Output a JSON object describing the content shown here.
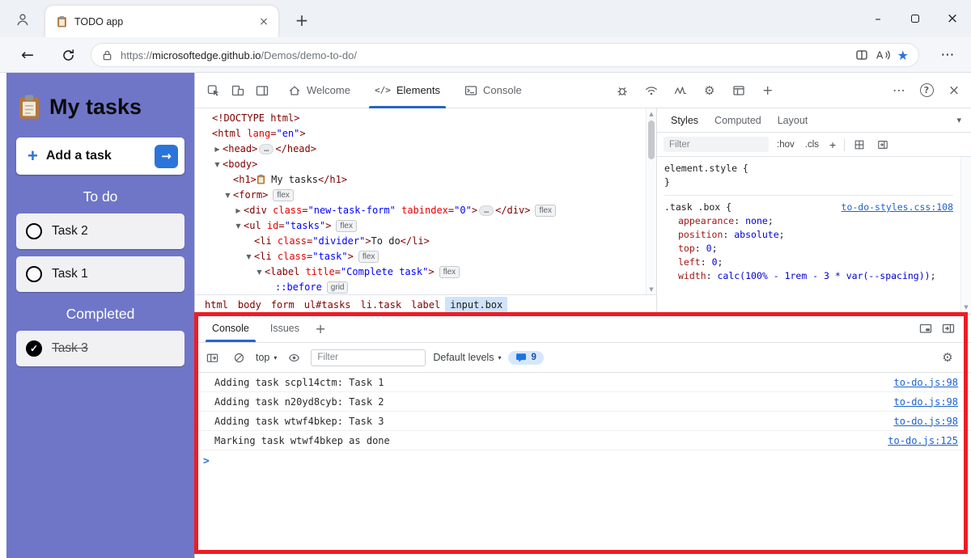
{
  "colors": {
    "app_purple": "#6f76c8",
    "accent_blue": "#2b74d9",
    "annotation_red": "#ee1c25",
    "link_blue": "#1b62d0",
    "devtools_active_tab": "#2864c8"
  },
  "glyphs": {
    "close": "×",
    "minimize": "–",
    "new_tab": "+",
    "back": "←",
    "more": "⋯",
    "help": "?",
    "star": "★",
    "caret_down": "▾",
    "check": "✓",
    "prompt": ">",
    "elements_code": "</>",
    "gear": "⚙",
    "plus": "+",
    "scroll_up": "▲",
    "scroll_down": "▼",
    "tree_expanded": "▼",
    "tree_collapsed": "▶"
  },
  "browser": {
    "tab": {
      "title": "TODO app"
    },
    "url": {
      "scheme": "https://",
      "host": "microsoftedge.github.io",
      "path": "/Demos/demo-to-do/"
    }
  },
  "app": {
    "title": "My tasks",
    "add_task": {
      "plus": "+",
      "label": "Add a task",
      "arrow": "→"
    },
    "sections": [
      {
        "label": "To do",
        "tasks": [
          {
            "label": "Task 2",
            "done": false
          },
          {
            "label": "Task 1",
            "done": false
          }
        ]
      },
      {
        "label": "Completed",
        "tasks": [
          {
            "label": "Task 3",
            "done": true
          }
        ]
      }
    ]
  },
  "devtools": {
    "tabs": {
      "welcome": "Welcome",
      "elements": "Elements",
      "console": "Console"
    },
    "elements_tree": [
      {
        "i": 0,
        "k": [
          {
            "c": "tag",
            "s": "<!DOCTYPE html>"
          }
        ]
      },
      {
        "i": 0,
        "k": [
          {
            "c": "tag",
            "s": "<html"
          },
          {
            "c": "attr",
            "s": " lang"
          },
          {
            "c": "tag",
            "s": "="
          },
          {
            "c": "val",
            "s": "\"en\""
          },
          {
            "c": "tag",
            "s": ">"
          }
        ]
      },
      {
        "i": 1,
        "a": "r",
        "k": [
          {
            "c": "tag",
            "s": "<head>"
          },
          {
            "e": "…"
          },
          {
            "c": "tag",
            "s": "</head>"
          }
        ]
      },
      {
        "i": 1,
        "a": "d",
        "k": [
          {
            "c": "tag",
            "s": "<body>"
          }
        ]
      },
      {
        "i": 2,
        "k": [
          {
            "c": "tag",
            "s": "<h1>"
          },
          {
            "ic": "clipboard"
          },
          {
            "c": "text",
            "s": " My tasks"
          },
          {
            "c": "tag",
            "s": "</h1>"
          }
        ]
      },
      {
        "i": 2,
        "a": "d",
        "k": [
          {
            "c": "tag",
            "s": "<form>"
          },
          {
            "b": "flex"
          }
        ]
      },
      {
        "i": 3,
        "a": "r",
        "k": [
          {
            "c": "tag",
            "s": "<div"
          },
          {
            "c": "attr",
            "s": " class"
          },
          {
            "c": "tag",
            "s": "="
          },
          {
            "c": "val",
            "s": "\"new-task-form\""
          },
          {
            "c": "attr",
            "s": " tabindex"
          },
          {
            "c": "tag",
            "s": "="
          },
          {
            "c": "val",
            "s": "\"0\""
          },
          {
            "c": "tag",
            "s": ">"
          },
          {
            "e": "…"
          },
          {
            "c": "tag",
            "s": "</div>"
          },
          {
            "b": "flex"
          }
        ]
      },
      {
        "i": 3,
        "a": "d",
        "k": [
          {
            "c": "tag",
            "s": "<ul"
          },
          {
            "c": "attr",
            "s": " id"
          },
          {
            "c": "tag",
            "s": "="
          },
          {
            "c": "val",
            "s": "\"tasks\""
          },
          {
            "c": "tag",
            "s": ">"
          },
          {
            "b": "flex"
          }
        ]
      },
      {
        "i": 4,
        "k": [
          {
            "c": "tag",
            "s": "<li"
          },
          {
            "c": "attr",
            "s": " class"
          },
          {
            "c": "tag",
            "s": "="
          },
          {
            "c": "val",
            "s": "\"divider\""
          },
          {
            "c": "tag",
            "s": ">"
          },
          {
            "c": "text",
            "s": "To do"
          },
          {
            "c": "tag",
            "s": "</li>"
          }
        ]
      },
      {
        "i": 4,
        "a": "d",
        "k": [
          {
            "c": "tag",
            "s": "<li"
          },
          {
            "c": "attr",
            "s": " class"
          },
          {
            "c": "tag",
            "s": "="
          },
          {
            "c": "val",
            "s": "\"task\""
          },
          {
            "c": "tag",
            "s": ">"
          },
          {
            "b": "flex"
          }
        ]
      },
      {
        "i": 5,
        "a": "d",
        "k": [
          {
            "c": "tag",
            "s": "<label"
          },
          {
            "c": "attr",
            "s": " title"
          },
          {
            "c": "tag",
            "s": "="
          },
          {
            "c": "val",
            "s": "\"Complete task\""
          },
          {
            "c": "tag",
            "s": ">"
          },
          {
            "b": "flex"
          }
        ]
      },
      {
        "i": 6,
        "k": [
          {
            "c": "pseudo",
            "s": "::before"
          },
          {
            "b": "grid"
          }
        ]
      }
    ],
    "breadcrumbs": [
      {
        "label": "html"
      },
      {
        "label": "body"
      },
      {
        "label": "form"
      },
      {
        "label": "ul#tasks"
      },
      {
        "label": "li.task"
      },
      {
        "label": "label"
      },
      {
        "label": "input.box",
        "selected": true
      }
    ],
    "styles_pane": {
      "tabs": [
        "Styles",
        "Computed",
        "Layout"
      ],
      "filter_placeholder": "Filter",
      "hov": ":hov",
      "cls": ".cls",
      "plus": "+",
      "rules": [
        {
          "selector": "element.style",
          "props": [],
          "closed": true
        },
        {
          "selector": ".task .box",
          "link": "to-do-styles.css:108",
          "closed": false,
          "props": [
            {
              "name": "appearance",
              "value": "none"
            },
            {
              "name": "position",
              "value": "absolute"
            },
            {
              "name": "top",
              "value": "0"
            },
            {
              "name": "left",
              "value": "0"
            },
            {
              "name": "width",
              "value": "calc(100% - 1rem - 3 * var(--spacing))"
            }
          ]
        }
      ]
    },
    "console_pane": {
      "tabs": [
        "Console",
        "Issues"
      ],
      "plus": "+",
      "context_selector": "top",
      "filter_placeholder": "Filter",
      "levels": "Default levels",
      "message_count": "9",
      "messages": [
        {
          "text": "Adding task scpl14ctm: Task 1",
          "source": "to-do.js:98"
        },
        {
          "text": "Adding task n20yd8cyb: Task 2",
          "source": "to-do.js:98"
        },
        {
          "text": "Adding task wtwf4bkep: Task 3",
          "source": "to-do.js:98"
        },
        {
          "text": "Marking task wtwf4bkep as done",
          "source": "to-do.js:125"
        }
      ],
      "prompt": ">"
    }
  }
}
